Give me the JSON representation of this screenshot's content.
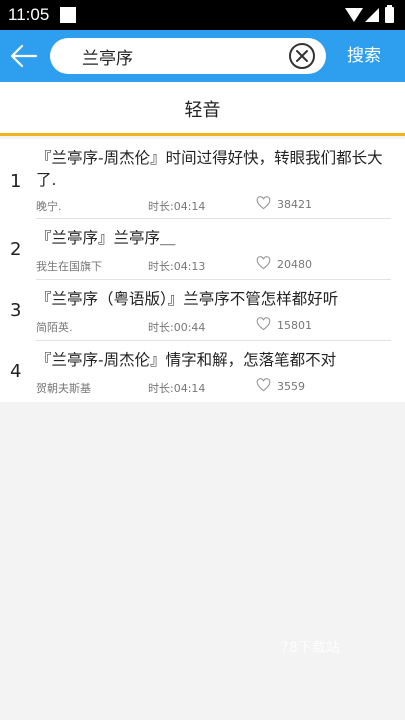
{
  "status": {
    "time": "11:05"
  },
  "search": {
    "query": "兰亭序",
    "button_label": "搜索"
  },
  "tab": {
    "label": "轻音"
  },
  "songs": [
    {
      "index": "1",
      "title": "『兰亭序-周杰伦』时间过得好快，转眼我们都长大了.",
      "artist": "晚宁.",
      "duration": "时长:04:14",
      "likes": "38421"
    },
    {
      "index": "2",
      "title": "『兰亭序』兰亭序＿",
      "artist": "我生在国旗下",
      "duration": "时长:04:13",
      "likes": "20480"
    },
    {
      "index": "3",
      "title": "『兰亭序（粤语版）』兰亭序不管怎样都好听",
      "artist": "简陌英.",
      "duration": "时长:00:44",
      "likes": "15801"
    },
    {
      "index": "4",
      "title": "『兰亭序-周杰伦』情字和解，怎落笔都不对",
      "artist": "贺朝夫斯基",
      "duration": "时长:04:14",
      "likes": "3559"
    }
  ],
  "watermark": "78下载站"
}
